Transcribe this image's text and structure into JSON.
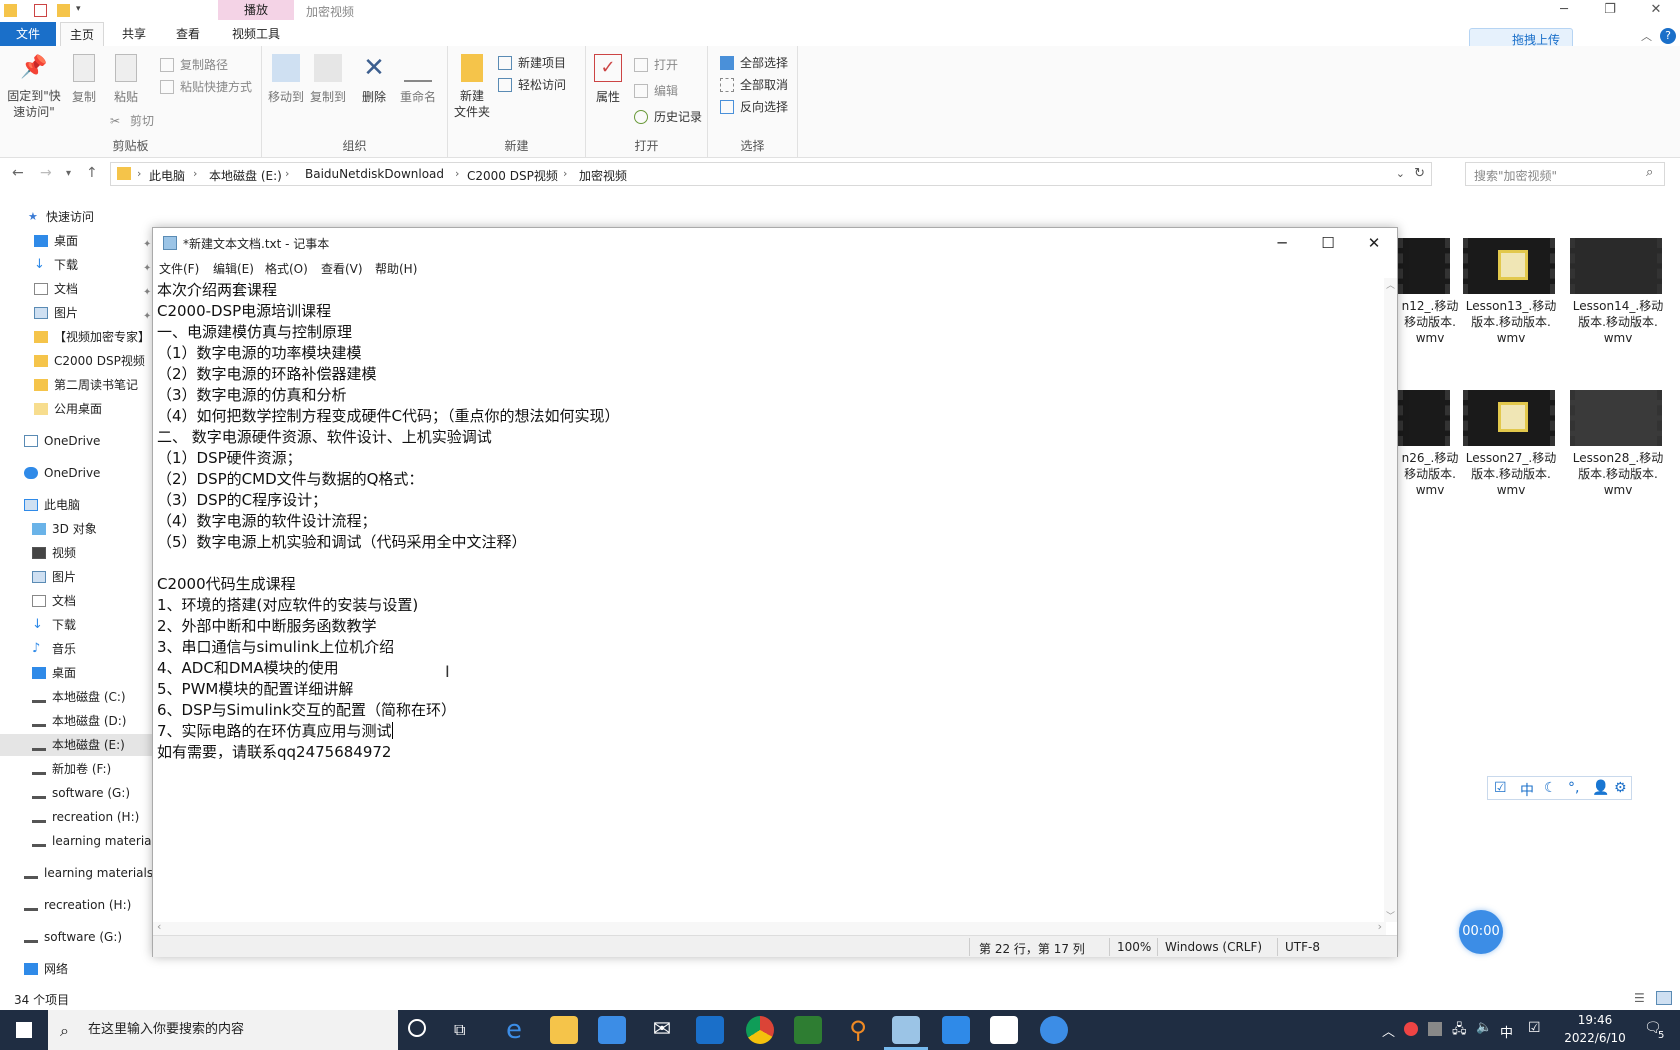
{
  "explorer": {
    "window_title": "加密视频",
    "context_tab": "播放",
    "tabs": [
      "文件",
      "主页",
      "共享",
      "查看",
      "视频工具"
    ],
    "upload_button": "拖拽上传",
    "ribbon": {
      "clipboard": {
        "label": "剪贴板",
        "pin": "固定到\"快\n速访问\"",
        "copy": "复制",
        "paste": "粘贴",
        "copy_path": "复制路径",
        "paste_shortcut": "粘贴快捷方式",
        "cut": "剪切"
      },
      "organize": {
        "label": "组织",
        "move_to": "移动到",
        "copy_to": "复制到",
        "delete": "删除",
        "rename": "重命名"
      },
      "new": {
        "label": "新建",
        "new_folder": "新建\n文件夹",
        "new_item": "新建项目",
        "easy_access": "轻松访问"
      },
      "open": {
        "label": "打开",
        "properties": "属性",
        "open": "打开",
        "edit": "编辑",
        "history": "历史记录"
      },
      "select": {
        "label": "选择",
        "select_all": "全部选择",
        "select_none": "全部取消",
        "invert": "反向选择"
      }
    },
    "breadcrumbs": [
      "此电脑",
      "本地磁盘 (E:)",
      "BaiduNetdiskDownload",
      "C2000 DSP视频",
      "加密视频"
    ],
    "search_placeholder": "搜索\"加密视频\"",
    "nav": [
      "快速访问",
      "桌面",
      "下载",
      "文档",
      "图片",
      "【视频加密专家】",
      "C2000 DSP视频",
      "第二周读书笔记",
      "公用桌面",
      "OneDrive",
      "OneDrive",
      "此电脑",
      "3D 对象",
      "视频",
      "图片",
      "文档",
      "下载",
      "音乐",
      "桌面",
      "本地磁盘 (C:)",
      "本地磁盘 (D:)",
      "本地磁盘 (E:)",
      "新加卷 (F:)",
      "software (G:)",
      "recreation (H:)",
      "learning material",
      "learning materials",
      "recreation (H:)",
      "software (G:)",
      "网络"
    ],
    "thumbnails": [
      {
        "line1": "n12_.移动",
        "line2": "移动版本.",
        "line3": "wmv"
      },
      {
        "line1": "Lesson13_.移动",
        "line2": "版本.移动版本.",
        "line3": "wmv"
      },
      {
        "line1": "Lesson14_.移动",
        "line2": "版本.移动版本.",
        "line3": "wmv"
      },
      {
        "line1": "n26_.移动",
        "line2": "移动版本.",
        "line3": "wmv"
      },
      {
        "line1": "Lesson27_.移动",
        "line2": "版本.移动版本.",
        "line3": "wmv"
      },
      {
        "line1": "Lesson28_.移动",
        "line2": "版本.移动版本.",
        "line3": "wmv"
      }
    ],
    "item_count": "34 个项目"
  },
  "notepad": {
    "title": "*新建文本文档.txt - 记事本",
    "menu": [
      "文件(F)",
      "编辑(E)",
      "格式(O)",
      "查看(V)",
      "帮助(H)"
    ],
    "lines": [
      "本次介绍两套课程",
      "C2000-DSP电源培训课程",
      "一、电源建模仿真与控制原理",
      "（1）数字电源的功率模块建模",
      "（2）数字电源的环路补偿器建模",
      "（3）数字电源的仿真和分析",
      "（4）如何把数学控制方程变成硬件C代码；（重点你的想法如何实现）",
      "二、 数字电源硬件资源、软件设计、上机实验调试",
      "（1）DSP硬件资源；",
      "（2）DSP的CMD文件与数据的Q格式：",
      "（3）DSP的C程序设计；",
      "（4）数字电源的软件设计流程；",
      "（5）数字电源上机实验和调试（代码采用全中文注释）",
      "",
      "C2000代码生成课程",
      "1、环境的搭建(对应软件的安装与设置)",
      "2、外部中断和中断服务函数教学",
      "3、串口通信与simulink上位机介绍",
      "4、ADC和DMA模块的使用",
      "5、PWM模块的配置详细讲解",
      "6、DSP与Simulink交互的配置（简称在环）",
      "7、实际电路的在环仿真应用与测试",
      "如有需要，请联系qq2475684972"
    ],
    "status": {
      "position": "第 22 行，第 17 列",
      "zoom": "100%",
      "line_ending": "Windows (CRLF)",
      "encoding": "UTF-8"
    }
  },
  "ime": {
    "mode": "中"
  },
  "timer": "00:00",
  "taskbar": {
    "search_placeholder": "在这里输入你要搜索的内容",
    "time": "19:46",
    "date": "2022/6/10",
    "tray_lang": "中",
    "notification_count": "5"
  }
}
